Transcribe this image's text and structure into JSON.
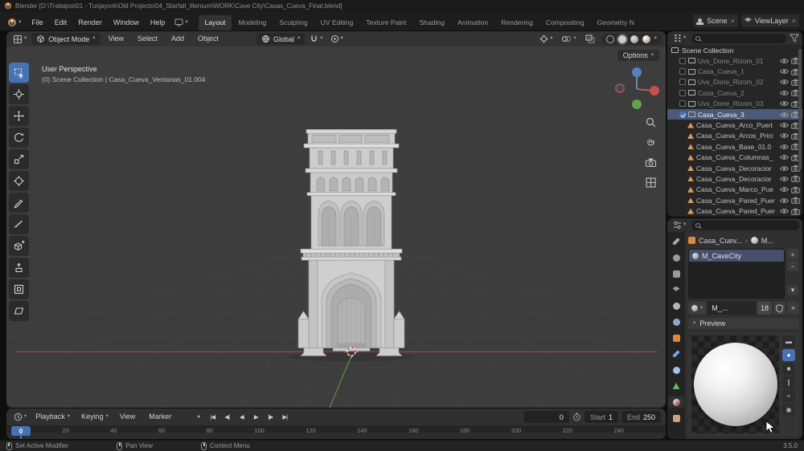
{
  "app": {
    "version": "3.5.0"
  },
  "titlebar": {
    "title": "Blender [D:\\Trabajos\\01 - Tunjayork\\Old Projects\\04_Starfall_Illenium\\WORK\\Cave City\\Casas_Cueva_Final.blend]"
  },
  "glyphs": {
    "chevron": "▾",
    "close": "×",
    "plus": "+",
    "minus": "−",
    "record": "●"
  },
  "topbar": {
    "menus": [
      "File",
      "Edit",
      "Render",
      "Window",
      "Help"
    ],
    "workspaces": [
      {
        "label": "Layout",
        "active": true
      },
      {
        "label": "Modeling"
      },
      {
        "label": "Sculpting"
      },
      {
        "label": "UV Editing"
      },
      {
        "label": "Texture Paint"
      },
      {
        "label": "Shading"
      },
      {
        "label": "Animation"
      },
      {
        "label": "Rendering"
      },
      {
        "label": "Compositing"
      },
      {
        "label": "Geometry Nodes",
        "clipped": true
      }
    ],
    "scene": {
      "label": "Scene"
    },
    "viewlayer": {
      "label": "ViewLayer"
    }
  },
  "viewport": {
    "header": {
      "mode": "Object Mode",
      "menus": [
        "View",
        "Select",
        "Add",
        "Object"
      ],
      "orientation": "Global",
      "options_label": "Options"
    },
    "overlay": {
      "line1": "User Perspective",
      "line2": "(0) Scene Collection | Casa_Cueva_Ventanas_01.004"
    }
  },
  "toolbar": {
    "tools": [
      "select-box",
      "cursor",
      "move",
      "rotate",
      "scale",
      "transform",
      "annotate",
      "measure",
      "add-cube",
      "extrude",
      "inset",
      "shear"
    ],
    "active_tool": "select-box"
  },
  "outliner": {
    "root_label": "Scene Collection",
    "items": [
      {
        "name": "Uvs_Done_Rizom_01",
        "type": "collection",
        "dim": true
      },
      {
        "name": "Casa_Cueva_1",
        "type": "collection",
        "dim": true
      },
      {
        "name": "Uvs_Done_Rizom_02",
        "type": "collection",
        "dim": true
      },
      {
        "name": "Casa_Cueva_2",
        "type": "collection",
        "dim": true
      },
      {
        "name": "Uvs_Done_Rizom_03",
        "type": "collection",
        "dim": true
      },
      {
        "name": "Casa_Cueva_3",
        "type": "collection",
        "selected": true,
        "checked": true
      },
      {
        "name": "Casa_Cueva_Arco_Puert",
        "type": "mesh"
      },
      {
        "name": "Casa_Cueva_Arcos_Prici",
        "type": "mesh"
      },
      {
        "name": "Casa_Cueva_Base_01.0",
        "type": "mesh"
      },
      {
        "name": "Casa_Cueva_Columnas_",
        "type": "mesh"
      },
      {
        "name": "Casa_Cueva_Decoracior",
        "type": "mesh"
      },
      {
        "name": "Casa_Cueva_Decoracior",
        "type": "mesh"
      },
      {
        "name": "Casa_Cueva_Marco_Pue",
        "type": "mesh"
      },
      {
        "name": "Casa_Cueva_Pared_Puer",
        "type": "mesh"
      },
      {
        "name": "Casa_Cueva_Pared_Puer",
        "type": "mesh"
      }
    ]
  },
  "properties": {
    "tabs": [
      {
        "name": "tool",
        "shape": "wrench",
        "color": "#a8a8a8"
      },
      {
        "name": "render",
        "shape": "circle",
        "color": "#9a9a9a"
      },
      {
        "name": "output",
        "shape": "square",
        "color": "#9a9a9a"
      },
      {
        "name": "view-layer",
        "shape": "layers",
        "color": "#9a9a9a"
      },
      {
        "name": "scene",
        "shape": "circle",
        "color": "#b5b5b5"
      },
      {
        "name": "world",
        "shape": "circle",
        "color": "#8fa8c8"
      },
      {
        "name": "object",
        "shape": "square",
        "color": "#e0873c"
      },
      {
        "name": "modifiers",
        "shape": "wrench",
        "color": "#7aa2e0"
      },
      {
        "name": "physics",
        "shape": "circle",
        "color": "#9fc3e0"
      },
      {
        "name": "object-data",
        "shape": "triangle",
        "color": "#5fbf5f"
      },
      {
        "name": "material",
        "shape": "sphere",
        "color": "#cf9090",
        "active": true
      },
      {
        "name": "texture",
        "shape": "square",
        "color": "#cf9f7f"
      }
    ],
    "breadcrumb": {
      "object": "Casa_Cuev...",
      "separator": "›",
      "data": "M..."
    },
    "slots": [
      {
        "name": "M_CaveCity",
        "selected": true
      }
    ],
    "material": {
      "name": "M_...",
      "users": "18"
    },
    "preview": {
      "title": "Preview",
      "modes": [
        {
          "name": "flat",
          "glyph": "▬"
        },
        {
          "name": "sphere",
          "glyph": "●",
          "active": true
        },
        {
          "name": "cube",
          "glyph": "■"
        },
        {
          "name": "hair",
          "glyph": "∥"
        },
        {
          "name": "cloth",
          "glyph": "≈"
        },
        {
          "name": "fluid",
          "glyph": "◉"
        }
      ]
    }
  },
  "timeline": {
    "menus": [
      {
        "label": "Playback",
        "caret": "▾"
      },
      {
        "label": "Keying",
        "caret": "▾"
      },
      {
        "label": "View",
        "caret": ""
      },
      {
        "label": "Marker",
        "caret": ""
      }
    ],
    "transport": [
      "|◀",
      "◀|",
      "◀",
      "▶",
      "|▶",
      "▶|"
    ],
    "frame": "0",
    "start_label": "Start",
    "start": "1",
    "end_label": "End",
    "end": "250",
    "playhead": "0",
    "ruler": [
      "0",
      "20",
      "40",
      "60",
      "80",
      "100",
      "120",
      "140",
      "160",
      "180",
      "200",
      "220",
      "240"
    ]
  },
  "statusbar": {
    "items": [
      {
        "label": "Set Active Modifier",
        "icon": "mouse-left"
      },
      {
        "label": "Pan View",
        "icon": "mouse-middle"
      },
      {
        "label": "Context Menu",
        "icon": "mouse-right"
      }
    ]
  }
}
